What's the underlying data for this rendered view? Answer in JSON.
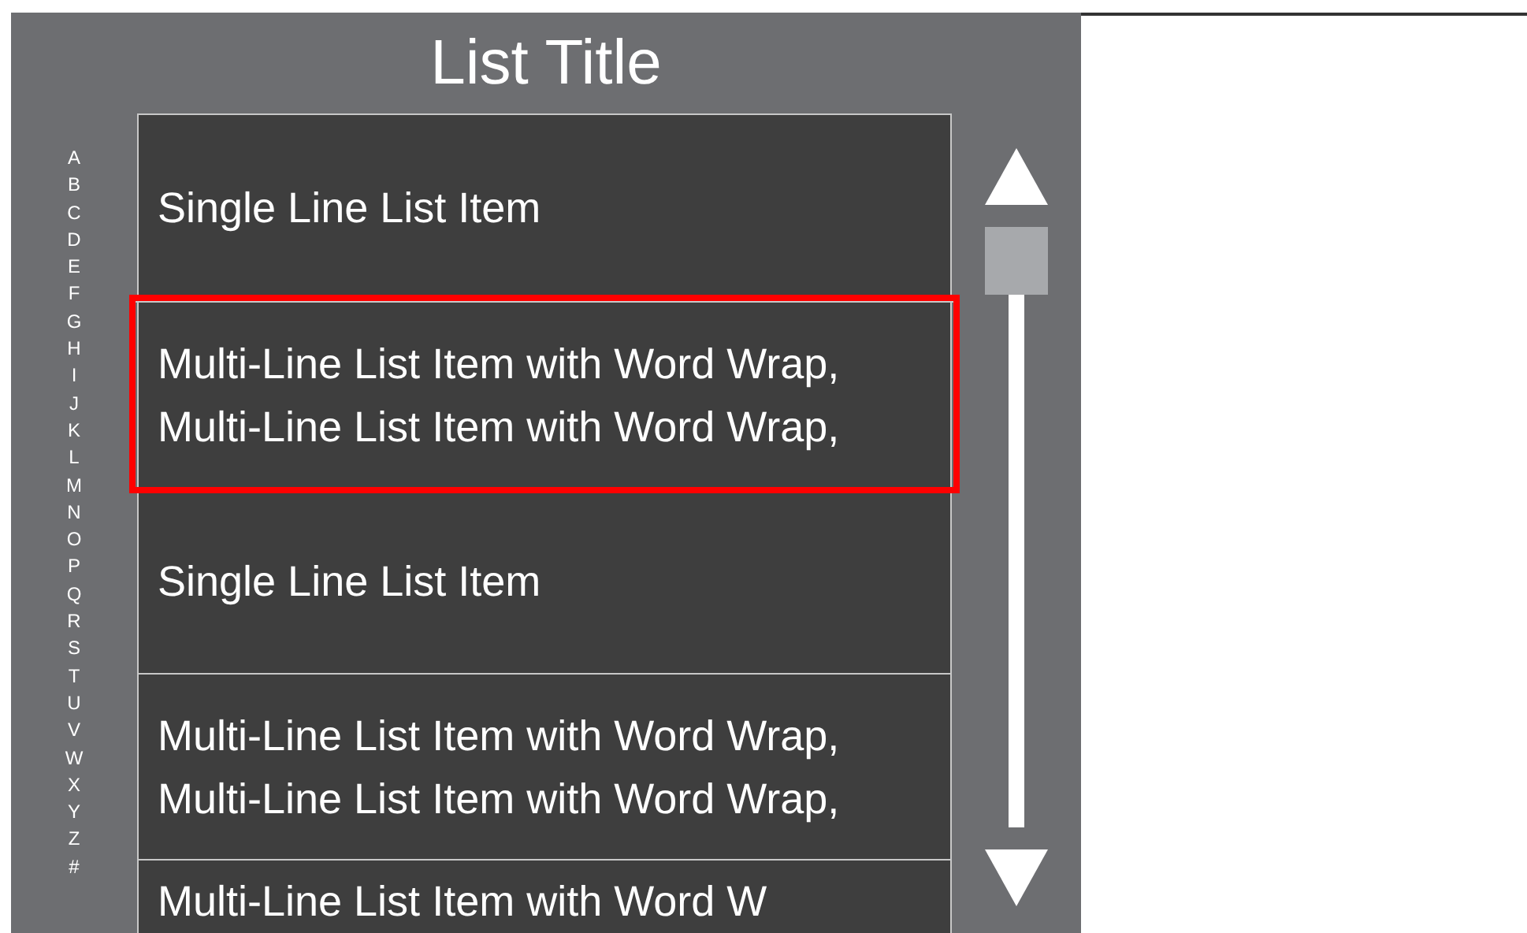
{
  "title": "List Title",
  "index_letters": [
    "A",
    "B",
    "C",
    "D",
    "E",
    "F",
    "G",
    "H",
    "I",
    "J",
    "K",
    "L",
    "M",
    "N",
    "O",
    "P",
    "Q",
    "R",
    "S",
    "T",
    "U",
    "V",
    "W",
    "X",
    "Y",
    "Z",
    "#"
  ],
  "items": [
    {
      "lines": [
        "Single Line List Item"
      ],
      "selected": false
    },
    {
      "lines": [
        "Multi-Line List Item with Word Wrap,",
        "Multi-Line List Item with Word Wrap,"
      ],
      "selected": true
    },
    {
      "lines": [
        "Single Line List Item"
      ],
      "selected": false
    },
    {
      "lines": [
        "Multi-Line List Item with Word Wrap,",
        "Multi-Line List Item with Word Wrap,"
      ],
      "selected": false
    },
    {
      "lines": [
        "Multi-Line List Item with Word W"
      ],
      "selected": false
    }
  ]
}
